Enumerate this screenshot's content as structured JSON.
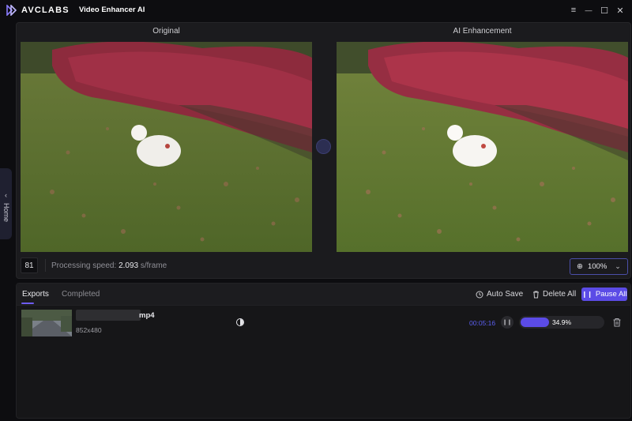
{
  "app": {
    "brand": "AVCLABS",
    "title": "Video Enhancer AI"
  },
  "window_controls": {
    "menu": "≡",
    "minimize": "—",
    "maximize": "☐",
    "close": "✕"
  },
  "sidebar": {
    "home_label": "Home",
    "chevron": "‹"
  },
  "preview": {
    "original_label": "Original",
    "enhanced_label": "AI Enhancement",
    "frame_number": "81",
    "speed_label": "Processing speed: ",
    "speed_value": "2.093",
    "speed_unit": " s/frame",
    "zoom_value": "100%",
    "zoom_icon": "⊕",
    "zoom_chevron": "⌄"
  },
  "exports": {
    "tabs": [
      {
        "label": "Exports",
        "active": true
      },
      {
        "label": "Completed",
        "active": false
      }
    ],
    "auto_save_label": "Auto Save",
    "delete_all_label": "Delete All",
    "pause_all_label": "Pause All",
    "items": [
      {
        "name_suffix": "mp4",
        "resolution": "852x480",
        "elapsed": "00:05:16",
        "progress_text": "34.9%",
        "progress": 0.349
      }
    ]
  },
  "colors": {
    "accent": "#5b4be6",
    "elapsed_text": "#5b5ff0",
    "background": "#0d0d10"
  }
}
